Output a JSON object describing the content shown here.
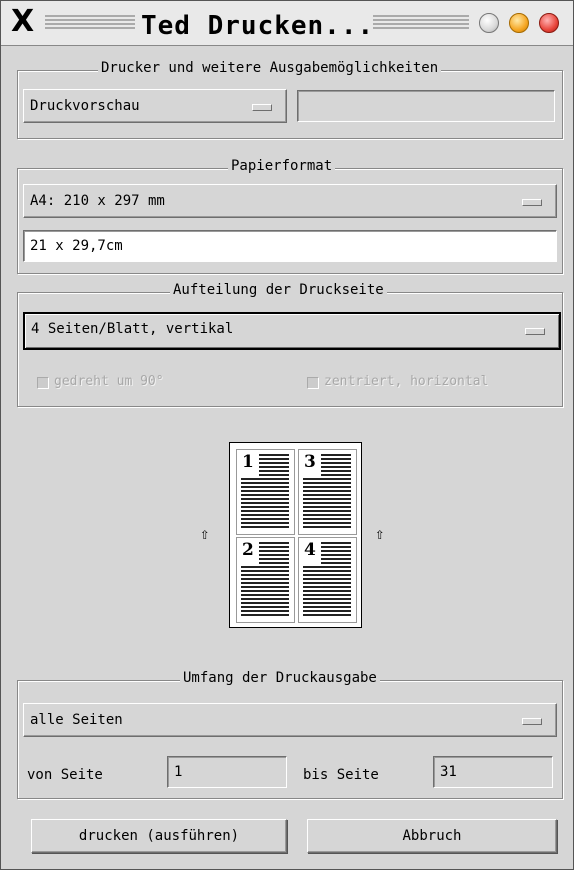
{
  "window": {
    "title": "Ted Drucken...",
    "close_glyph": "X"
  },
  "printer": {
    "legend": "Drucker und weitere Ausgabemöglichkeiten",
    "selected": "Druckvorschau",
    "extra_value": ""
  },
  "paper": {
    "legend": "Papierformat",
    "selected": "A4: 210 x 297 mm",
    "custom_value": "21 x 29,7cm"
  },
  "layout": {
    "legend": "Aufteilung der Druckseite",
    "selected": "4 Seiten/Blatt, vertikal",
    "rotated_label": "gedreht um 90°",
    "centered_label": "zentriert, horizontal",
    "preview_pages": [
      "1",
      "3",
      "2",
      "4"
    ]
  },
  "range": {
    "legend": "Umfang der Druckausgabe",
    "selected": "alle Seiten",
    "from_label": "von Seite",
    "from_value": "1",
    "to_label": "bis Seite",
    "to_value": "31"
  },
  "actions": {
    "print_label": "drucken (ausführen)",
    "cancel_label": "Abbruch"
  }
}
